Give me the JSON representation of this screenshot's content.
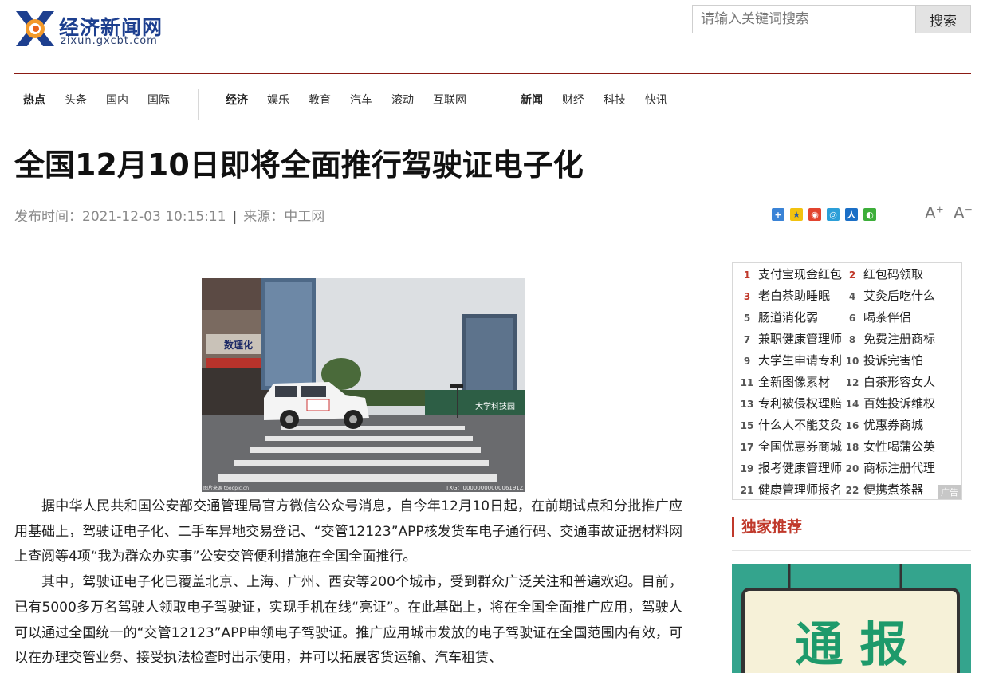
{
  "site": {
    "name": "经济新闻网",
    "url": "zixun.gxcbt.com"
  },
  "search": {
    "placeholder": "请输入关键词搜索",
    "button_label": "搜索"
  },
  "nav": {
    "group1": [
      {
        "label": "热点",
        "bold": true
      },
      {
        "label": "头条",
        "bold": false
      },
      {
        "label": "国内",
        "bold": false
      },
      {
        "label": "国际",
        "bold": false
      }
    ],
    "group2": [
      {
        "label": "经济",
        "bold": true
      },
      {
        "label": "娱乐",
        "bold": false
      },
      {
        "label": "教育",
        "bold": false
      },
      {
        "label": "汽车",
        "bold": false
      },
      {
        "label": "滚动",
        "bold": false
      },
      {
        "label": "互联网",
        "bold": false
      }
    ],
    "group3": [
      {
        "label": "新闻",
        "bold": true
      },
      {
        "label": "财经",
        "bold": false
      },
      {
        "label": "科技",
        "bold": false
      },
      {
        "label": "快讯",
        "bold": false
      }
    ]
  },
  "article": {
    "title": "全国12月10日即将全面推行驾驶证电子化",
    "publish_label": "发布时间：",
    "publish_time": "2021-12-03 10:15:11",
    "source_label": "来源：",
    "source": "中工网",
    "photo_sign": "大学科技园",
    "photo_store": "数理化",
    "photo_watermark": "TXG：0000000000006191Z",
    "photo_credit": "图片来源 tooopic.cn",
    "paragraphs": [
      "据中华人民共和国公安部交通管理局官方微信公众号消息，自今年12月10日起，在前期试点和分批推广应用基础上，驾驶证电子化、二手车异地交易登记、“交管12123”APP核发货车电子通行码、交通事故证据材料网上查阅等4项“我为群众办实事”公安交管便利措施在全国全面推行。",
      "其中，驾驶证电子化已覆盖北京、上海、广州、西安等200个城市，受到群众广泛关注和普遍欢迎。目前，已有5000多万名驾驶人领取电子驾驶证，实现手机在线“亮证”。在此基础上，将在全国全面推广应用，驾驶人可以通过全国统一的“交管12123”APP申领电子驾驶证。推广应用城市发放的电子驾驶证在全国范围内有效，可以在办理交管业务、接受执法检查时出示使用，并可以拓展客货运输、汽车租赁、"
    ]
  },
  "share_icons": [
    "qzone-icon",
    "favorite-icon",
    "weibo-icon",
    "tencent-weibo-icon",
    "renren-icon",
    "wechat-icon"
  ],
  "font_controls": {
    "increase": "A",
    "decrease": "A"
  },
  "hot_list": [
    {
      "num": "1",
      "text": "支付宝现金红包"
    },
    {
      "num": "2",
      "text": "红包码领取"
    },
    {
      "num": "3",
      "text": "老白茶助睡眠"
    },
    {
      "num": "4",
      "text": "艾灸后吃什么"
    },
    {
      "num": "5",
      "text": "肠道消化弱"
    },
    {
      "num": "6",
      "text": "喝茶伴侣"
    },
    {
      "num": "7",
      "text": "兼职健康管理师"
    },
    {
      "num": "8",
      "text": "免费注册商标"
    },
    {
      "num": "9",
      "text": "大学生申请专利"
    },
    {
      "num": "10",
      "text": "投诉完害怕"
    },
    {
      "num": "11",
      "text": "全新图像素材"
    },
    {
      "num": "12",
      "text": "白茶形容女人"
    },
    {
      "num": "13",
      "text": "专利被侵权理赔"
    },
    {
      "num": "14",
      "text": "百姓投诉维权"
    },
    {
      "num": "15",
      "text": "什么人不能艾灸"
    },
    {
      "num": "16",
      "text": "优惠券商城"
    },
    {
      "num": "17",
      "text": "全国优惠券商城"
    },
    {
      "num": "18",
      "text": "女性喝蒲公英"
    },
    {
      "num": "19",
      "text": "报考健康管理师"
    },
    {
      "num": "20",
      "text": "商标注册代理"
    },
    {
      "num": "21",
      "text": "健康管理师报名"
    },
    {
      "num": "22",
      "text": "便携煮茶器"
    }
  ],
  "ad_tag": "广告",
  "exclusive": {
    "heading": "独家推荐",
    "promo_text": "通 报"
  },
  "colors": {
    "brand_red": "#8b1a13",
    "accent_red": "#c0392b",
    "logo_blue": "#1d3f8f",
    "promo_green": "#2fa08a"
  }
}
